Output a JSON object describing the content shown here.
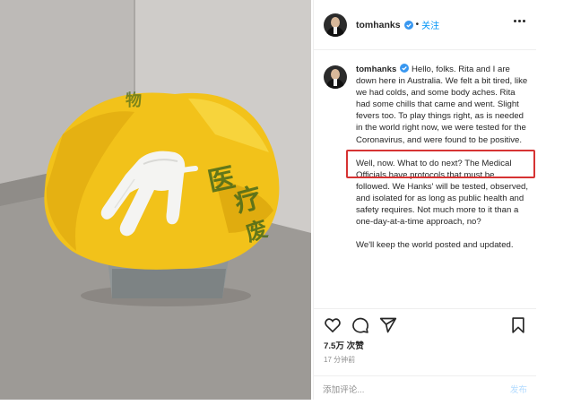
{
  "post": {
    "username": "tomhanks",
    "follow_label": "关注",
    "dot": "•",
    "caption_paragraphs": [
      "Hello, folks. Rita and I are down here in Australia. We felt a bit tired, like we had colds, and some body aches. Rita had some chills that came and went. Slight fevers too. To play things right, as is needed in the world right now, we were tested for the Coronavirus, and were found to be positive.",
      "Well, now. What to do next? The Medical Officials have protocols that must be followed. We Hanks' will be tested, observed, and isolated for as long as public health and safety requires. Not much more to it than a one-day-at-a-time approach, no?",
      "We'll keep the world posted and updated."
    ],
    "likes": "7.5万 次赞",
    "time": "17 分钟前",
    "comment_placeholder": "添加评论...",
    "post_button": "发布"
  },
  "photo": {
    "bag_label_chars": "医疗废物"
  },
  "icons": [
    "heart-icon",
    "comment-icon",
    "share-icon",
    "bookmark-icon",
    "more-options-icon",
    "verified-icon"
  ],
  "colors": {
    "link_blue": "#0095f6",
    "highlight_red": "#d63333",
    "bag_yellow": "#f2c21a",
    "muted": "#8e8e8e"
  }
}
